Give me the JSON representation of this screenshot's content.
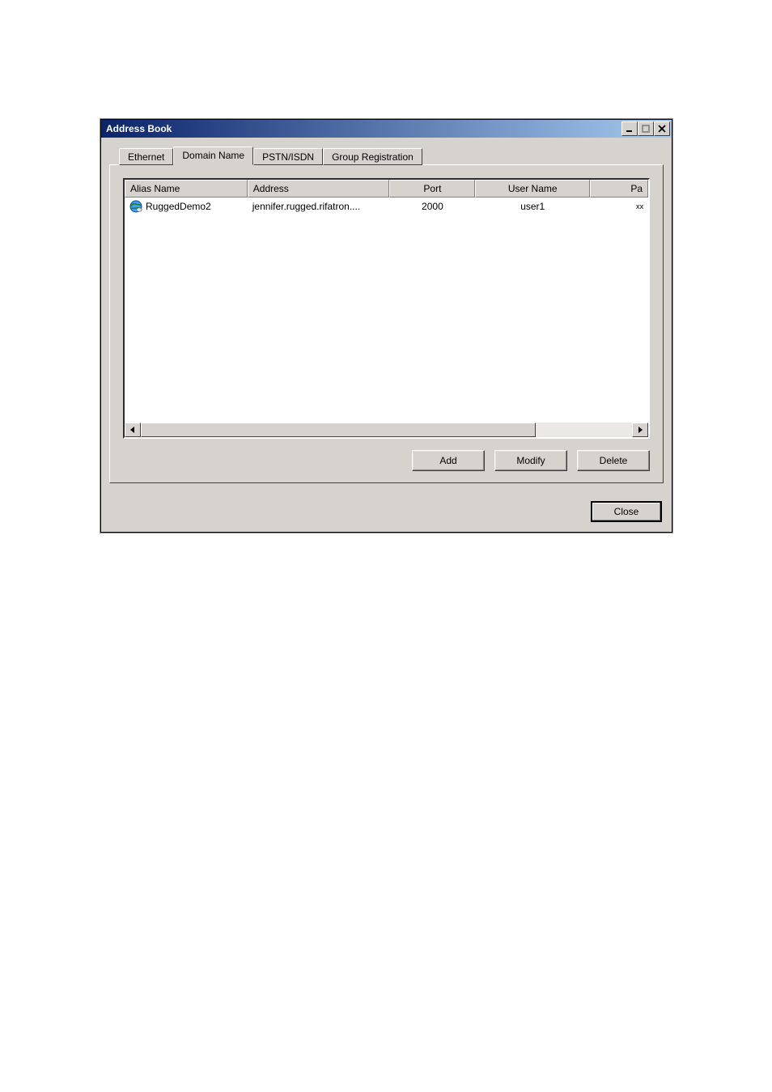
{
  "window": {
    "title": "Address Book"
  },
  "tabs": [
    {
      "label": "Ethernet"
    },
    {
      "label": "Domain Name"
    },
    {
      "label": "PSTN/ISDN"
    },
    {
      "label": "Group Registration"
    }
  ],
  "active_tab_index": 1,
  "table": {
    "columns": [
      {
        "label": "Alias Name",
        "align": "left"
      },
      {
        "label": "Address",
        "align": "left"
      },
      {
        "label": "Port",
        "align": "center"
      },
      {
        "label": "User Name",
        "align": "center"
      },
      {
        "label": "Pa",
        "align": "right"
      }
    ],
    "rows": [
      {
        "icon": "globe-icon",
        "alias": "RuggedDemo2",
        "address": "jennifer.rugged.rifatron....",
        "port": "2000",
        "user": "user1",
        "pass_masked": "xx"
      }
    ]
  },
  "buttons": {
    "add": "Add",
    "modify": "Modify",
    "delete": "Delete",
    "close": "Close"
  }
}
